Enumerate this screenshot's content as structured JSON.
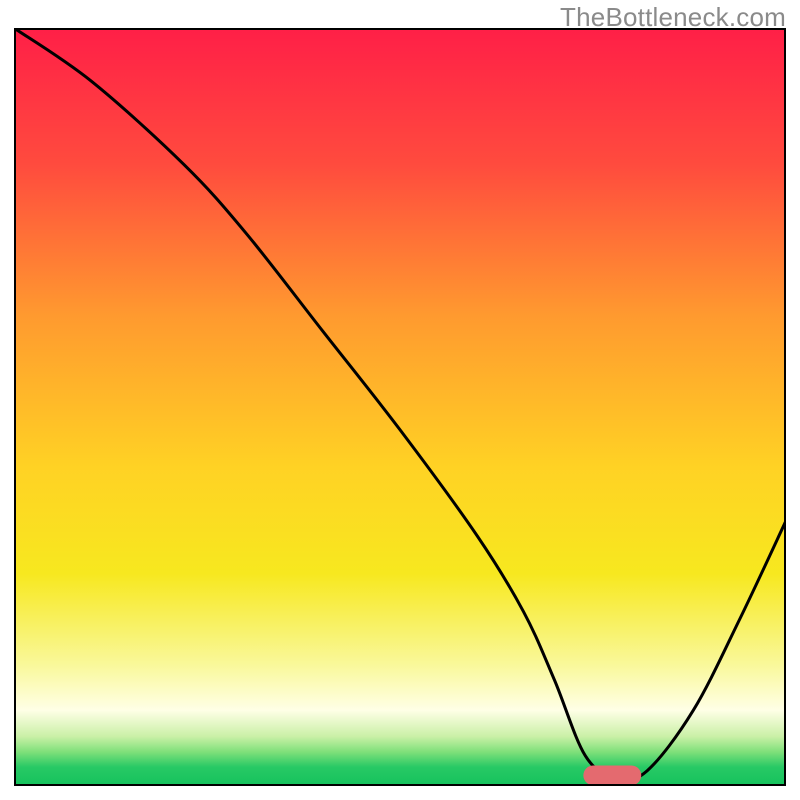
{
  "watermark": "TheBottleneck.com",
  "chart_data": {
    "type": "line",
    "title": "",
    "xlabel": "",
    "ylabel": "",
    "xlim": [
      0,
      100
    ],
    "ylim": [
      0,
      100
    ],
    "background_gradient": {
      "stops": [
        {
          "offset": 0.0,
          "color": "#ff1f47"
        },
        {
          "offset": 0.18,
          "color": "#ff4b3e"
        },
        {
          "offset": 0.38,
          "color": "#ff9a2f"
        },
        {
          "offset": 0.58,
          "color": "#ffd224"
        },
        {
          "offset": 0.72,
          "color": "#f7e81f"
        },
        {
          "offset": 0.84,
          "color": "#f9f89a"
        },
        {
          "offset": 0.9,
          "color": "#ffffe6"
        },
        {
          "offset": 0.935,
          "color": "#c9f0a6"
        },
        {
          "offset": 0.955,
          "color": "#7fe07a"
        },
        {
          "offset": 0.975,
          "color": "#28c965"
        },
        {
          "offset": 1.0,
          "color": "#14c25c"
        }
      ]
    },
    "series": [
      {
        "name": "bottleneck-curve",
        "color": "#000000",
        "stroke_width": 3,
        "x": [
          0,
          10,
          22,
          30,
          40,
          50,
          60,
          66,
          70,
          74,
          78,
          82,
          88,
          94,
          100
        ],
        "y": [
          100,
          93,
          82,
          73,
          60,
          47,
          33,
          23,
          14,
          4,
          1,
          2,
          10,
          22,
          35
        ]
      }
    ],
    "marker": {
      "name": "optimal-range",
      "x_center": 77.5,
      "y": 1.4,
      "length": 7.5,
      "thickness": 2.6,
      "color": "#e46a6f"
    },
    "frame": {
      "color": "#000000",
      "width": 2
    }
  }
}
